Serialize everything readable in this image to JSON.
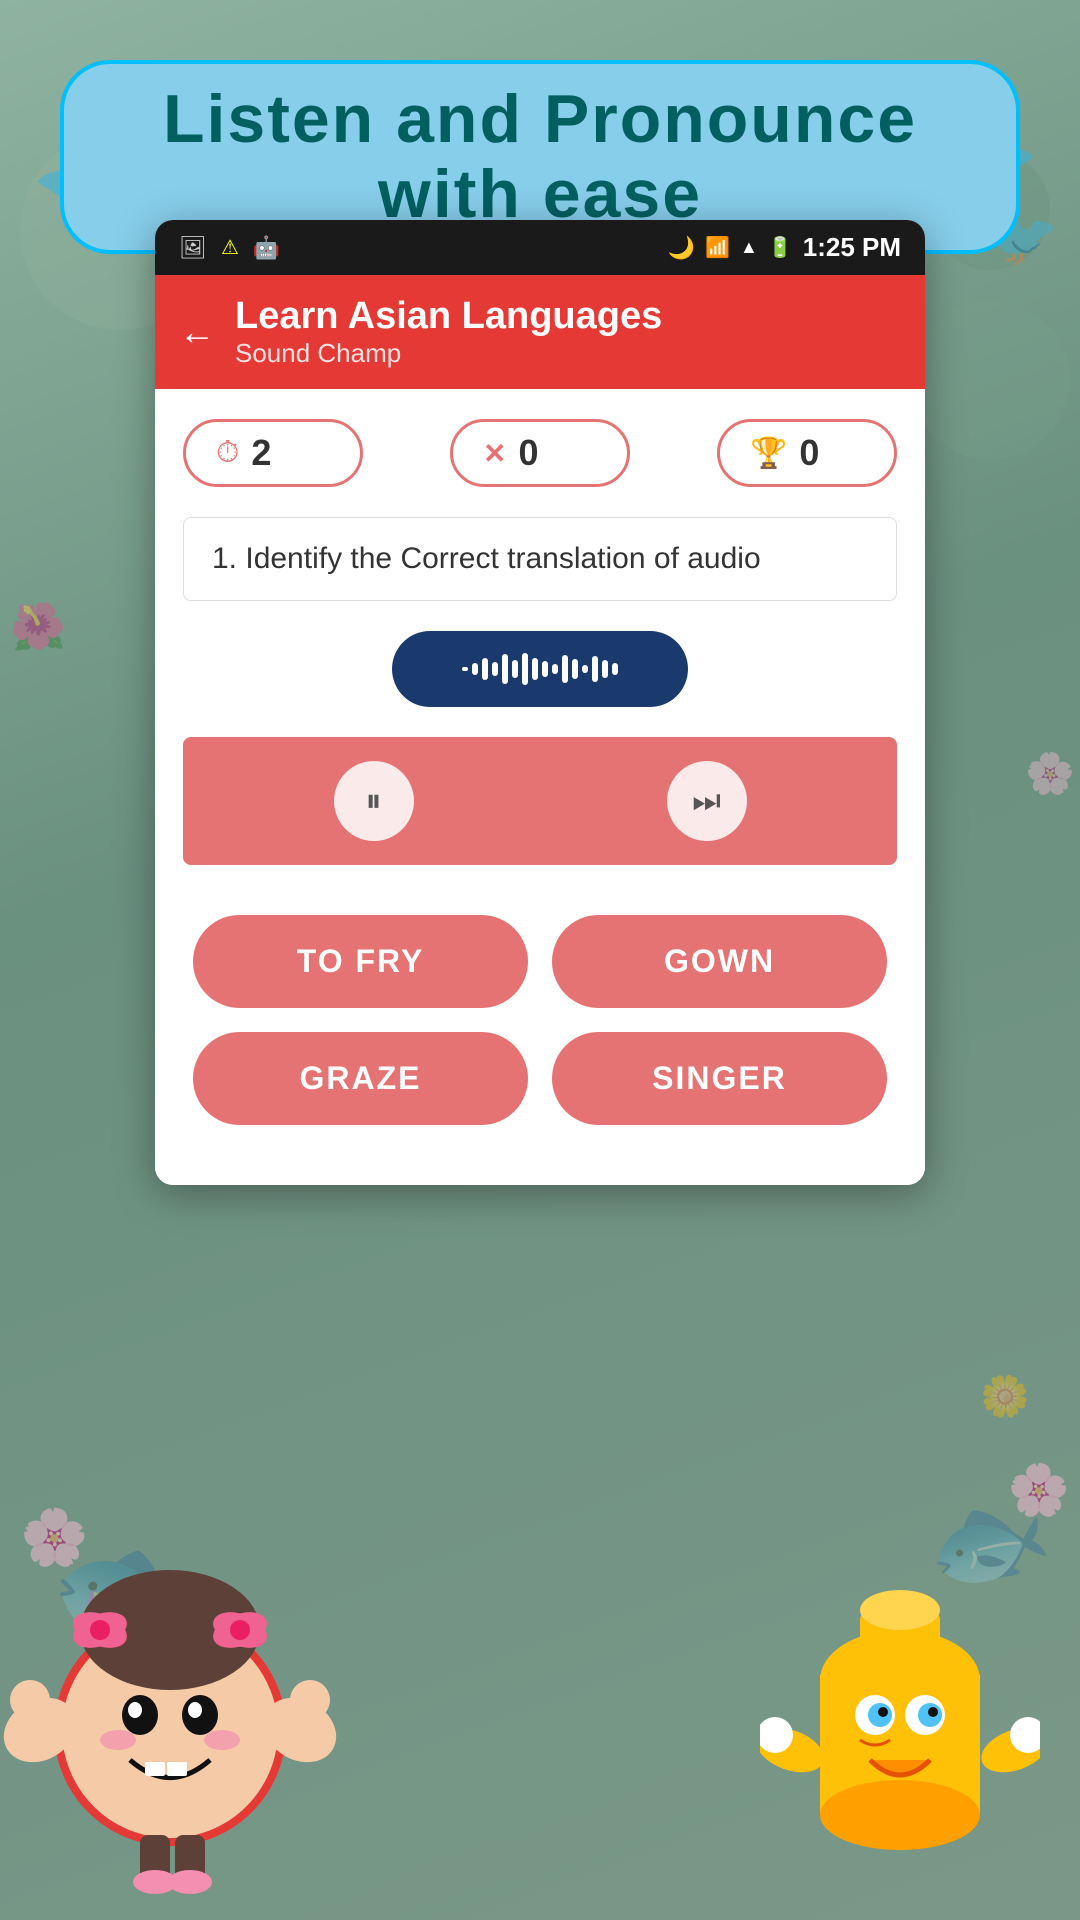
{
  "header": {
    "banner_text": "Listen and Pronounce with ease",
    "background_color": "#87CEEB",
    "border_color": "#00BFFF",
    "text_color": "#006060"
  },
  "status_bar": {
    "time": "1:25 PM",
    "icons": [
      "image-icon",
      "alert-icon",
      "android-icon",
      "moon-icon",
      "wifi-icon",
      "signal-icon",
      "battery-icon"
    ]
  },
  "app_bar": {
    "title": "Learn Asian Languages",
    "subtitle": "Sound Champ",
    "back_label": "←",
    "background_color": "#E53935"
  },
  "scores": [
    {
      "icon": "clock",
      "value": "2",
      "label": "timer"
    },
    {
      "icon": "close",
      "value": "0",
      "label": "wrong"
    },
    {
      "icon": "trophy",
      "value": "0",
      "label": "score"
    }
  ],
  "question": "1. Identify the Correct translation of  audio",
  "controls": {
    "pause_label": "⏸",
    "skip_label": "⏭"
  },
  "answers": [
    {
      "label": "TO FRY"
    },
    {
      "label": "GOWN"
    },
    {
      "label": "GRAZE"
    },
    {
      "label": "SINGER"
    }
  ],
  "wave_bars": [
    4,
    12,
    22,
    14,
    30,
    18,
    32,
    22,
    16,
    10,
    28,
    20,
    8,
    26,
    18,
    12
  ],
  "colors": {
    "red_primary": "#E53935",
    "red_light": "#E57373",
    "navy": "#1a3a6e",
    "sky": "#87CEEB"
  }
}
